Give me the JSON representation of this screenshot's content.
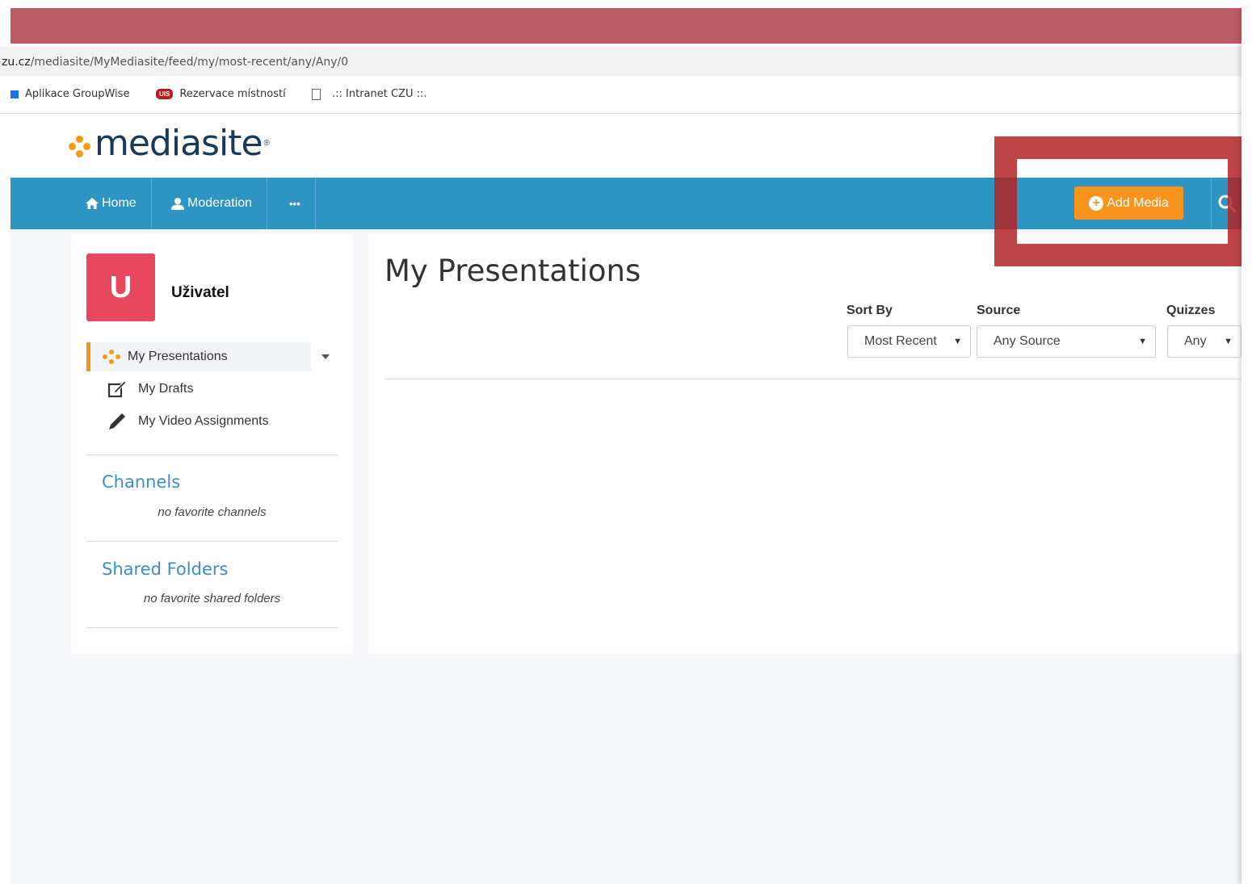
{
  "browser": {
    "url_host": "zu.cz",
    "url_path": "/mediasite/MyMediasite/feed/my/most-recent/any/Any/0",
    "bookmarks": [
      "Aplikace GroupWise",
      "Rezervace místností",
      ".:: Intranet CZU ::."
    ],
    "bookmark_badge": "UIS"
  },
  "header": {
    "logo_text": "mediasite",
    "logo_mark": "®"
  },
  "nav": {
    "home": "Home",
    "moderation": "Moderation",
    "more": "•••",
    "add_media": "Add Media"
  },
  "sidebar": {
    "avatar_letter": "U",
    "username": "Uživatel",
    "items": [
      {
        "label": "My Presentations",
        "icon": "presentations-dots-icon"
      },
      {
        "label": "My Drafts",
        "icon": "edit-icon"
      },
      {
        "label": "My Video Assignments",
        "icon": "pencil-icon"
      }
    ],
    "channels_title": "Channels",
    "channels_empty": "no favorite channels",
    "shared_title": "Shared Folders",
    "shared_empty": "no favorite shared folders"
  },
  "main": {
    "title": "My Presentations",
    "filters": {
      "sort_label": "Sort By",
      "sort_value": "Most Recent",
      "source_label": "Source",
      "source_value": "Any Source",
      "quizzes_label": "Quizzes",
      "quizzes_value": "Any"
    }
  },
  "colors": {
    "navbar": "#2e94c2",
    "accent": "#f7941d",
    "avatar": "#e8485f",
    "highlight": "#b32424"
  }
}
